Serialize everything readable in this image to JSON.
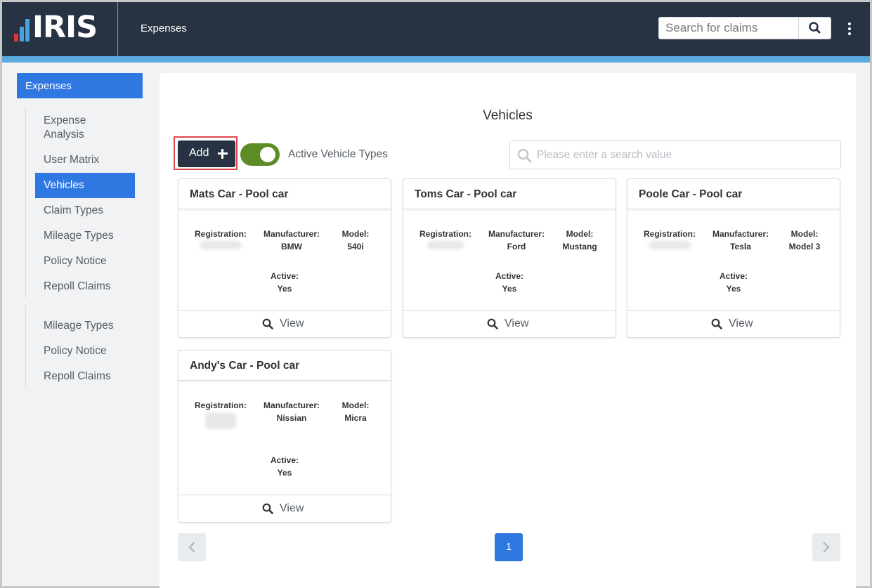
{
  "header": {
    "logo_text": "IRIS",
    "app_title": "Expenses",
    "search_placeholder": "Search for claims",
    "colors": {
      "bg": "#273342",
      "accent_bar": "#5aabdf",
      "logo_red": "#e2323a",
      "logo_blue": "#4aa3df"
    }
  },
  "sidebar": {
    "main": "Expenses",
    "group1": [
      "Expense Analysis",
      "User Matrix",
      "Vehicles",
      "Claim Types",
      "Mileage Types",
      "Policy Notice",
      "Repoll Claims"
    ],
    "group2": [
      "Mileage Types",
      "Policy Notice",
      "Repoll Claims"
    ],
    "active": "Vehicles"
  },
  "main": {
    "title": "Vehicles",
    "add_label": "Add",
    "toggle_label": "Active Vehicle Types",
    "toggle_on": true,
    "search_placeholder": "Please enter a search value"
  },
  "labels": {
    "registration": "Registration:",
    "manufacturer": "Manufacturer:",
    "model": "Model:",
    "active": "Active:",
    "view": "View"
  },
  "vehicles": [
    {
      "title": "Mats Car - Pool car",
      "manufacturer": "BMW",
      "model": "540i",
      "active": "Yes"
    },
    {
      "title": "Toms Car - Pool car",
      "manufacturer": "Ford",
      "model": "Mustang",
      "active": "Yes"
    },
    {
      "title": "Poole Car - Pool car",
      "manufacturer": "Tesla",
      "model": "Model 3",
      "active": "Yes"
    },
    {
      "title": "Andy's Car - Pool car",
      "manufacturer": "Nissian",
      "model": "Micra",
      "active": "Yes"
    }
  ],
  "pagination": {
    "current": "1"
  }
}
